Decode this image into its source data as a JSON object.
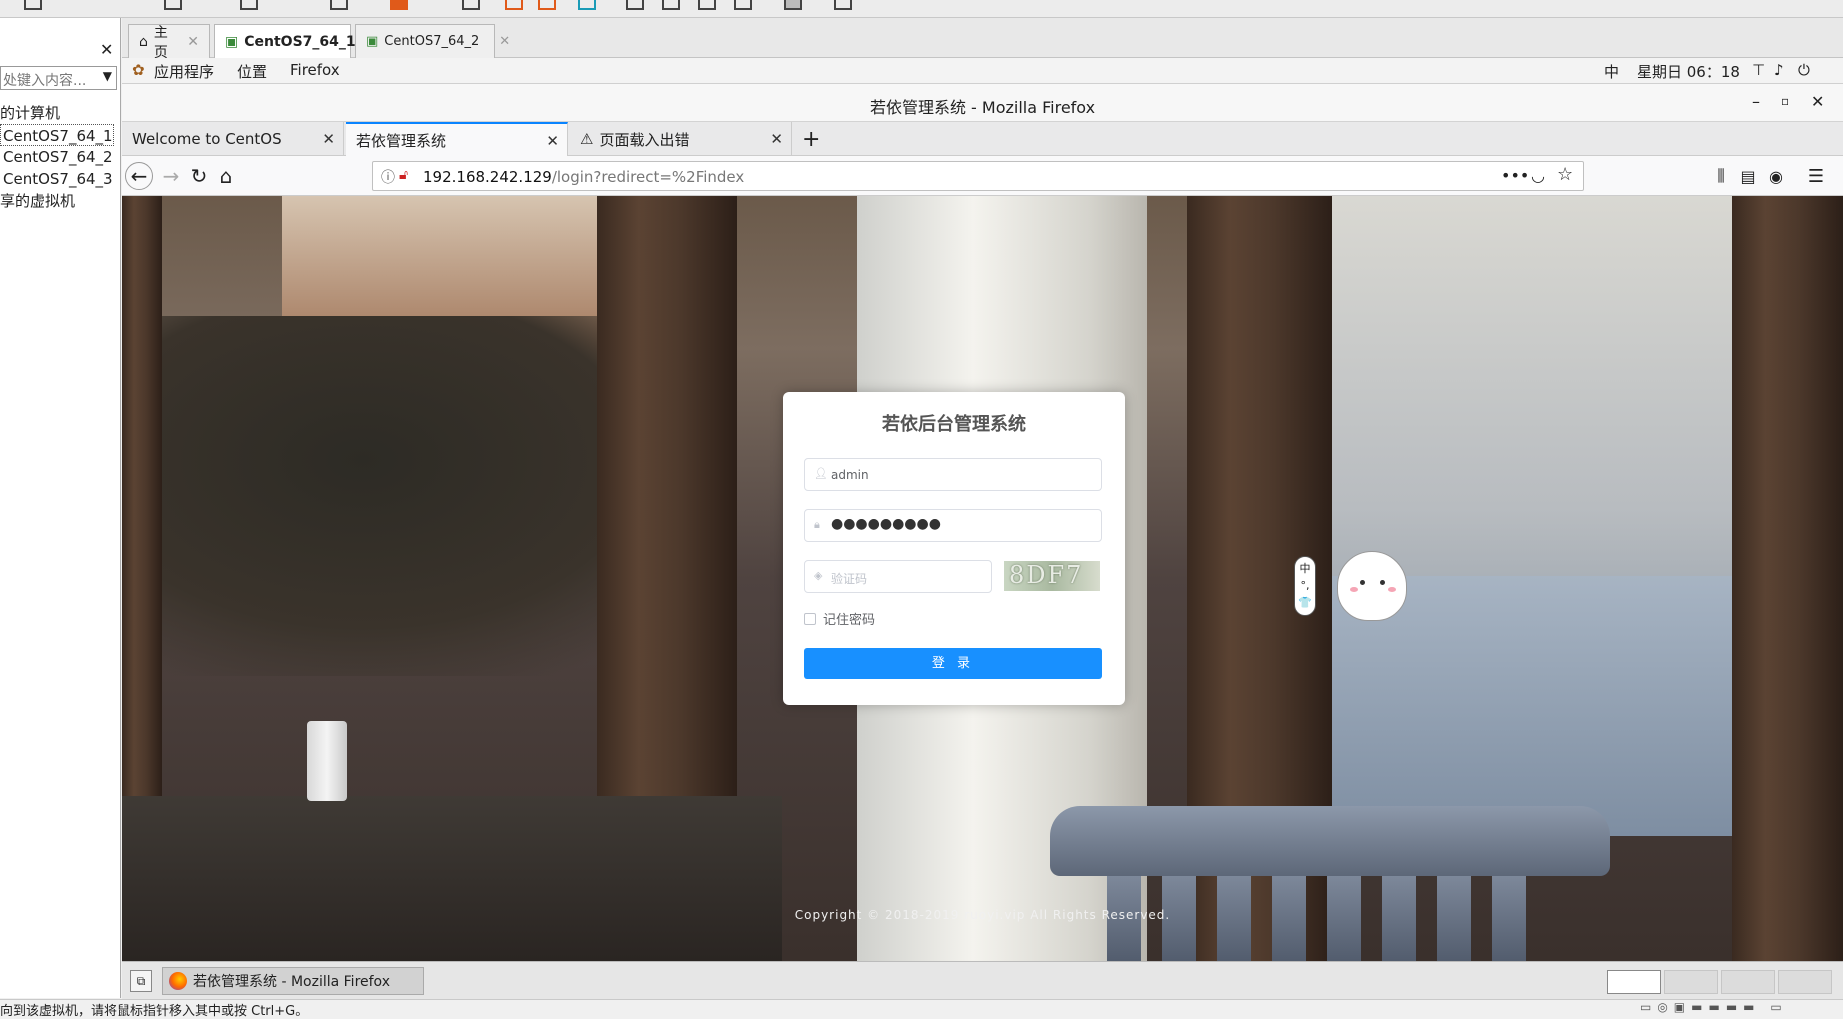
{
  "vm_sidebar": {
    "close": "✕",
    "search_placeholder": "处键入内容...",
    "items": [
      "的计算机",
      "CentOS7_64_1",
      "CentOS7_64_2",
      "CentOS7_64_3",
      "享的虚拟机"
    ],
    "selected": 1
  },
  "vm_tabs": [
    {
      "label": "主页",
      "icon": "home-icon"
    },
    {
      "label": "CentOS7_64_1",
      "icon": "vm-running-icon",
      "active": true
    },
    {
      "label": "CentOS7_64_2",
      "icon": "vm-running-icon"
    }
  ],
  "gnome_bar": {
    "apps": "应用程序",
    "places": "位置",
    "firefox": "Firefox",
    "ime": "中",
    "clock": "星期日 06：18"
  },
  "firefox": {
    "window_title": "若依管理系统 - Mozilla Firefox",
    "tabs": [
      {
        "label": "Welcome to CentOS"
      },
      {
        "label": "若依管理系统",
        "active": true
      },
      {
        "label": "页面载入出错",
        "icon": "warning-icon"
      }
    ],
    "url_host": "192.168.242.129",
    "url_path": "/login?redirect=%2Findex"
  },
  "login": {
    "title": "若依后台管理系统",
    "username": "admin",
    "password_mask": "●●●●●●●●●",
    "captcha_placeholder": "验证码",
    "captcha_text": "8DF7",
    "remember_label": "记住密码",
    "submit_label": "登 录",
    "copyright": "Copyright © 2018-2019 ruoyi.vip All Rights Reserved."
  },
  "ime_widget": {
    "chars": [
      "中",
      "°,",
      "👕"
    ]
  },
  "taskbar": {
    "task_label": "若依管理系统 - Mozilla Firefox"
  },
  "status_bar": {
    "text": "向到该虚拟机，请将鼠标指针移入其中或按 Ctrl+G。"
  }
}
